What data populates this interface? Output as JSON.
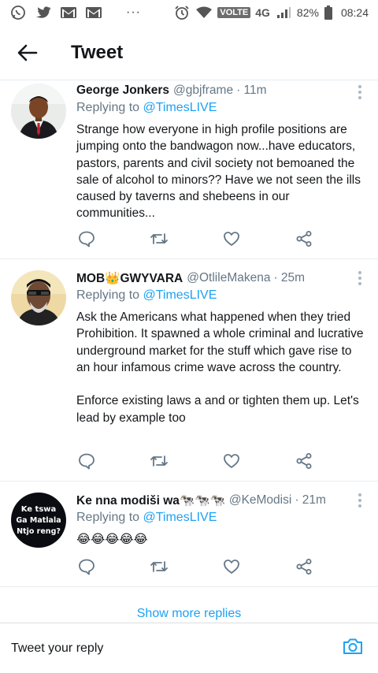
{
  "status_bar": {
    "volte": "VOLTE",
    "network": "4G",
    "battery": "82%",
    "time": "08:24",
    "icons": [
      "whatsapp-icon",
      "twitter-icon",
      "gmail-icon",
      "gmail-icon",
      "more-dots-icon",
      "alarm-icon",
      "wifi-icon",
      "signal-icon",
      "battery-icon"
    ]
  },
  "header": {
    "title": "Tweet",
    "back_icon": "back-arrow-icon"
  },
  "tweets": [
    {
      "name": "George Jonkers",
      "handle": "@gbjframe",
      "time": "· 11m",
      "replying_prefix": "Replying to ",
      "replying_handle": "@TimesLIVE",
      "text": "Strange how everyone in high profile positions are jumping onto the bandwagon now...have educators, pastors, parents and civil society not bemoaned the sale of alcohol to minors??  Have we not seen the ills caused by taverns and shebeens in our communities..."
    },
    {
      "name": "MOB👑GWYVARA",
      "handle": "@OtlileMakena",
      "time": "· 25m",
      "replying_prefix": "Replying to ",
      "replying_handle": "@TimesLIVE",
      "text": "Ask the Americans what happened when they tried Prohibition. It spawned a whole criminal and lucrative underground market for the stuff which gave rise to an hour infamous crime wave across the country.\n\nEnforce existing laws a and or tighten them up. Let's lead by example too"
    },
    {
      "name": "Ke nna modiši wa🐄🐄🐄",
      "handle": "@KeModisi",
      "time": "· 21m",
      "replying_prefix": "Replying to ",
      "replying_handle": "@TimesLIVE",
      "text": "😂😂😂😂😂",
      "avatar_text": "Ke tswa Ga Matlala Ntjo reng?"
    }
  ],
  "show_more": "Show more replies",
  "reply": {
    "placeholder": "Tweet your reply",
    "camera_icon": "camera-icon"
  },
  "colors": {
    "accent": "#1da1f2",
    "secondary_text": "#657786",
    "icon_gray": "#657786",
    "divider": "#e6ecf0"
  }
}
